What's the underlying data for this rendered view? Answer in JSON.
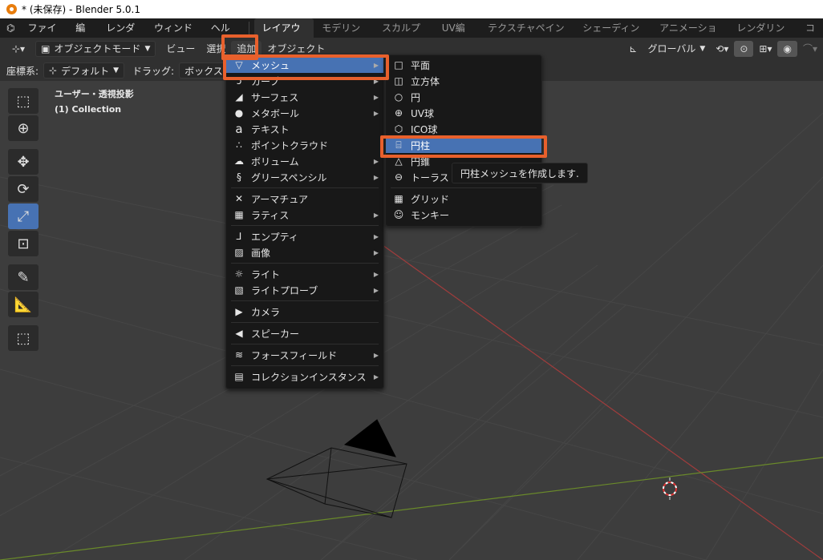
{
  "window": {
    "title": "* (未保存) - Blender 5.0.1"
  },
  "menubar": {
    "items": [
      "ファイル",
      "編集",
      "レンダー",
      "ウィンドウ",
      "ヘルプ"
    ],
    "workspaces": [
      "レイアウト",
      "モデリング",
      "スカルプト",
      "UV編集",
      "テクスチャペイント",
      "シェーディング",
      "アニメーション",
      "レンダリング",
      "コ"
    ],
    "active_workspace": "レイアウト"
  },
  "header": {
    "mode": "オブジェクトモード",
    "view": "ビュー",
    "select": "選択",
    "add": "追加",
    "object": "オブジェクト",
    "transform_orientation": "グローバル"
  },
  "toolheader": {
    "coord_label": "座標系:",
    "coord_value": "デフォルト",
    "drag_label": "ドラッグ:",
    "drag_value": "ボックス選"
  },
  "viewport": {
    "view_name": "ユーザー・透視投影",
    "collection": "(1) Collection"
  },
  "add_menu": {
    "items": [
      {
        "label": "メッシュ",
        "icon": "mesh-icon",
        "submenu": true
      },
      {
        "label": "カーブ",
        "icon": "curve-icon",
        "submenu": true
      },
      {
        "label": "サーフェス",
        "icon": "surface-icon",
        "submenu": true
      },
      {
        "label": "メタボール",
        "icon": "metaball-icon",
        "submenu": true
      },
      {
        "label": "テキスト",
        "icon": "text-icon",
        "submenu": false
      },
      {
        "label": "ポイントクラウド",
        "icon": "pointcloud-icon",
        "submenu": false
      },
      {
        "label": "ボリューム",
        "icon": "volume-icon",
        "submenu": true
      },
      {
        "label": "グリースペンシル",
        "icon": "grease-pencil-icon",
        "submenu": true
      },
      {
        "label": "アーマチュア",
        "icon": "armature-icon",
        "submenu": false
      },
      {
        "label": "ラティス",
        "icon": "lattice-icon",
        "submenu": true
      },
      {
        "label": "エンプティ",
        "icon": "empty-icon",
        "submenu": true
      },
      {
        "label": "画像",
        "icon": "image-icon",
        "submenu": true
      },
      {
        "label": "ライト",
        "icon": "light-icon",
        "submenu": true
      },
      {
        "label": "ライトプローブ",
        "icon": "light-probe-icon",
        "submenu": true
      },
      {
        "label": "カメラ",
        "icon": "camera-icon",
        "submenu": false
      },
      {
        "label": "スピーカー",
        "icon": "speaker-icon",
        "submenu": false
      },
      {
        "label": "フォースフィールド",
        "icon": "force-field-icon",
        "submenu": true
      },
      {
        "label": "コレクションインスタンス",
        "icon": "collection-instance-icon",
        "submenu": true
      }
    ]
  },
  "mesh_menu": {
    "items": [
      {
        "label": "平面",
        "icon": "plane-icon"
      },
      {
        "label": "立方体",
        "icon": "cube-icon"
      },
      {
        "label": "円",
        "icon": "circle-icon"
      },
      {
        "label": "UV球",
        "icon": "uv-sphere-icon"
      },
      {
        "label": "ICO球",
        "icon": "ico-sphere-icon"
      },
      {
        "label": "円柱",
        "icon": "cylinder-icon"
      },
      {
        "label": "円錐",
        "icon": "cone-icon"
      },
      {
        "label": "トーラス",
        "icon": "torus-icon"
      },
      {
        "label": "グリッド",
        "icon": "grid-icon"
      },
      {
        "label": "モンキー",
        "icon": "monkey-icon"
      }
    ]
  },
  "tooltip": "円柱メッシュを作成します.",
  "colors": {
    "highlight": "#4772b3",
    "annotation": "#e8602c",
    "x_axis": "#a03c3c",
    "y_axis": "#6a8a2a"
  }
}
